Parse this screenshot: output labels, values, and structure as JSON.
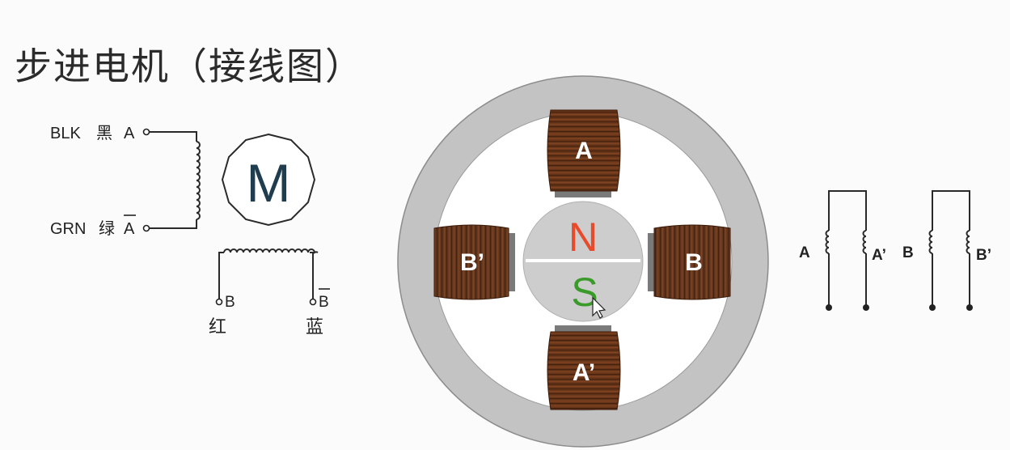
{
  "title": "步进电机（接线图）",
  "wiring": {
    "motor_symbol": "M",
    "terminals": [
      {
        "id": "blk",
        "code": "BLK",
        "color_cn": "黑",
        "phase": "A"
      },
      {
        "id": "grn",
        "code": "GRN",
        "color_cn": "绿",
        "phase": "A"
      },
      {
        "id": "red",
        "color_cn": "红",
        "phase": "B"
      },
      {
        "id": "blu",
        "color_cn": "蓝",
        "phase": "B"
      }
    ]
  },
  "motor": {
    "coils": [
      {
        "id": "top",
        "label": "A"
      },
      {
        "id": "right",
        "label": "B"
      },
      {
        "id": "bottom",
        "label": "A’"
      },
      {
        "id": "left",
        "label": "B’"
      }
    ],
    "rotor": {
      "north": "N",
      "south": "S"
    },
    "colors": {
      "stator": "#c3c3c3",
      "coil": "#6a3619",
      "rotor": "#cdcdcd",
      "north": "#e84a2a",
      "south": "#3a9a2a"
    }
  },
  "schematic": {
    "coils": [
      {
        "id": "a",
        "label": "A"
      },
      {
        "id": "a-prime",
        "label": "A’"
      },
      {
        "id": "b",
        "label": "B"
      },
      {
        "id": "b-prime",
        "label": "B’"
      }
    ]
  }
}
